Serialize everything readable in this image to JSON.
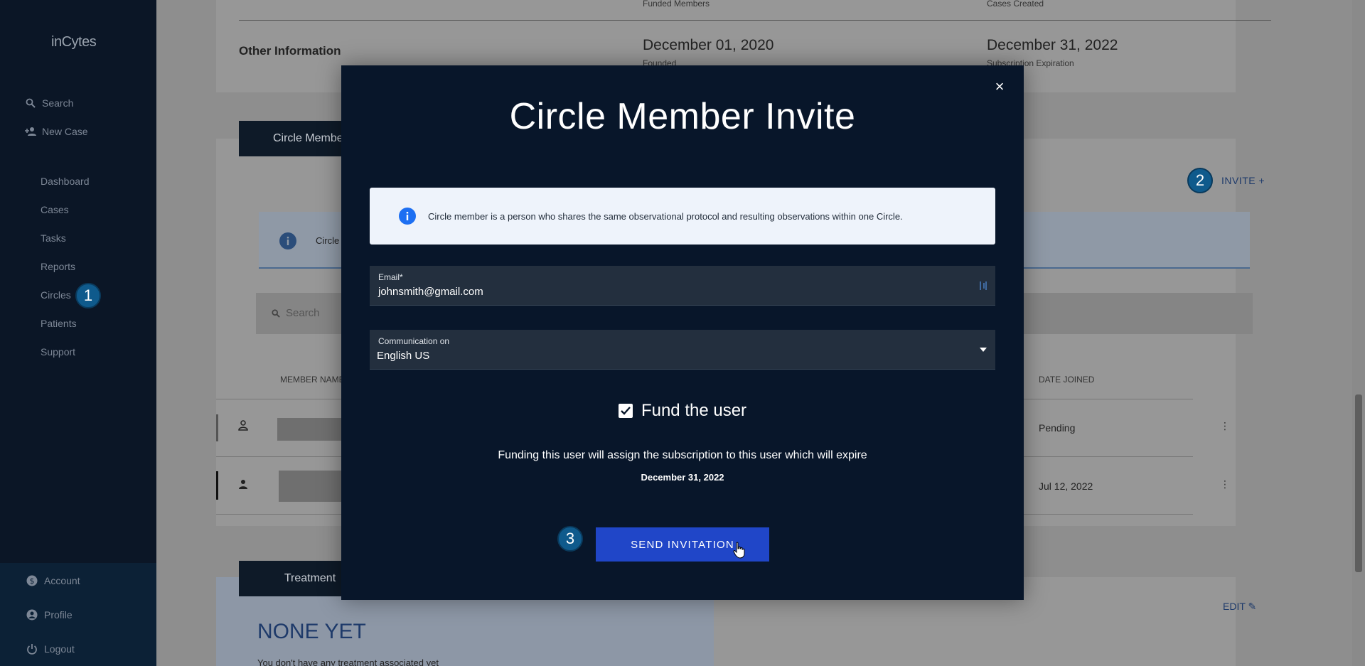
{
  "app": {
    "logo": "inCytes"
  },
  "sidebar": {
    "quick": [
      {
        "label": "Search",
        "icon": "search-icon"
      },
      {
        "label": "New Case",
        "icon": "add-person-icon"
      }
    ],
    "items": [
      {
        "label": "Dashboard"
      },
      {
        "label": "Cases"
      },
      {
        "label": "Tasks"
      },
      {
        "label": "Reports"
      },
      {
        "label": "Circles"
      },
      {
        "label": "Patients"
      },
      {
        "label": "Support"
      }
    ],
    "bottom": [
      {
        "label": "Account",
        "icon": "dollar-icon"
      },
      {
        "label": "Profile",
        "icon": "user-circle-icon"
      },
      {
        "label": "Logout",
        "icon": "power-icon"
      }
    ]
  },
  "steps": {
    "one": "1",
    "two": "2",
    "three": "3"
  },
  "background": {
    "funded_members": "Funded Members",
    "cases_created": "Cases Created",
    "other_info": "Other Information",
    "founded_date": "December 01, 2020",
    "founded_label": "Founded",
    "expiration_date": "December 31, 2022",
    "expiration_label": "Subscription Expiration",
    "members_tab": "Circle Member",
    "invite_label": "INVITE",
    "info_text": "Circle",
    "search_placeholder": "Search",
    "col_member_name": "MEMBER NAME",
    "col_date_joined": "DATE JOINED",
    "row1_date": "Pending",
    "row2_date": "Jul 12, 2022",
    "treatment_tab": "Treatment",
    "edit_label": "EDIT",
    "none_yet": "NONE YET",
    "no_treatment": "You don't have any treatment associated yet"
  },
  "modal": {
    "title": "Circle Member Invite",
    "info": "Circle member is a person who shares the same observational protocol and resulting observations within one Circle.",
    "email_label": "Email*",
    "email_value": "johnsmith@gmail.com",
    "comm_label": "Communication on",
    "comm_value": "English US",
    "fund_label": "Fund the user",
    "fund_checked": true,
    "fund_note": "Funding this user will assign the subscription to this user which will expire",
    "fund_date": "December 31, 2022",
    "send_label": "SEND INVITATION",
    "close": "×"
  }
}
